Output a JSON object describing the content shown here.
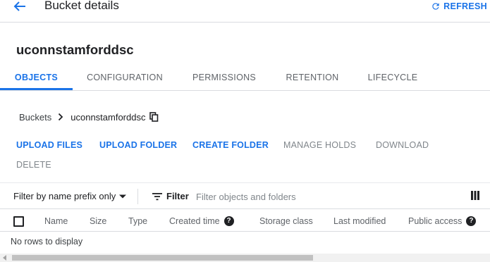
{
  "header": {
    "title": "Bucket details",
    "refresh_label": "REFRESH"
  },
  "bucket": {
    "name": "uconnstamforddsc"
  },
  "tabs": [
    {
      "label": "OBJECTS",
      "active": true
    },
    {
      "label": "CONFIGURATION",
      "active": false
    },
    {
      "label": "PERMISSIONS",
      "active": false
    },
    {
      "label": "RETENTION",
      "active": false
    },
    {
      "label": "LIFECYCLE",
      "active": false
    }
  ],
  "breadcrumb": {
    "root": "Buckets",
    "current": "uconnstamforddsc"
  },
  "actions": {
    "upload_files": "UPLOAD FILES",
    "upload_folder": "UPLOAD FOLDER",
    "create_folder": "CREATE FOLDER",
    "manage_holds": "MANAGE HOLDS",
    "download": "DOWNLOAD",
    "delete": "DELETE"
  },
  "filter": {
    "prefix_select": "Filter by name prefix only",
    "filter_label": "Filter",
    "placeholder": "Filter objects and folders"
  },
  "table": {
    "columns": [
      "Name",
      "Size",
      "Type",
      "Created time",
      "Storage class",
      "Last modified",
      "Public access"
    ],
    "empty_text": "No rows to display"
  },
  "colors": {
    "accent": "#1a73e8",
    "text": "#202124",
    "muted": "#5f6368",
    "disabled": "#80868b",
    "divider": "#dadce0"
  },
  "icons": [
    "arrow-back-icon",
    "refresh-icon",
    "chevron-right-icon",
    "copy-icon",
    "dropdown-arrow-icon",
    "filter-list-icon",
    "column-display-icon",
    "help-icon",
    "scroll-left-icon"
  ]
}
